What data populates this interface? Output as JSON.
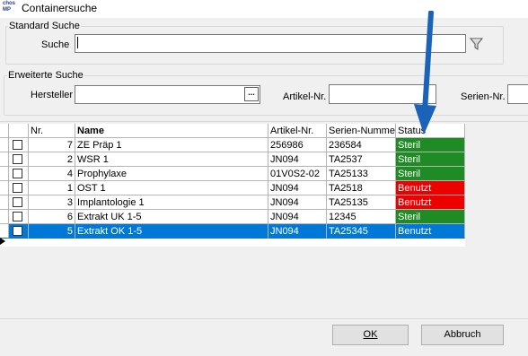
{
  "window": {
    "title": "Containersuche",
    "logo_line1": "chos",
    "logo_line2": "MP"
  },
  "standard_search": {
    "group_label": "Standard Suche",
    "search_label": "Suche",
    "search_value": ""
  },
  "extended_search": {
    "group_label": "Erweiterte Suche",
    "hersteller_label": "Hersteller",
    "hersteller_value": "",
    "hersteller_button": "...",
    "artikel_label": "Artikel-Nr.",
    "artikel_value": "",
    "serien_label": "Serien-Nr.",
    "serien_value": ""
  },
  "grid": {
    "columns": [
      "Nr.",
      "Name",
      "Artikel-Nr.",
      "Serien-Nummer",
      "Status"
    ],
    "rows": [
      {
        "nr": "7",
        "name": "ZE Präp 1",
        "artikel": "256986",
        "serien": "236584",
        "status": "Steril",
        "status_color": "#1f8b24"
      },
      {
        "nr": "2",
        "name": "WSR 1",
        "artikel": "JN094",
        "serien": "TA2537",
        "status": "Steril",
        "status_color": "#1f8b24"
      },
      {
        "nr": "4",
        "name": "Prophylaxe",
        "artikel": "01V0S2-02",
        "serien": "TA25133",
        "status": "Steril",
        "status_color": "#1f8b24"
      },
      {
        "nr": "1",
        "name": "OST 1",
        "artikel": "JN094",
        "serien": "TA2518",
        "status": "Benutzt",
        "status_color": "#ee0000"
      },
      {
        "nr": "3",
        "name": "Implantologie 1",
        "artikel": "JN094",
        "serien": "TA25135",
        "status": "Benutzt",
        "status_color": "#ee0000"
      },
      {
        "nr": "6",
        "name": "Extrakt UK 1-5",
        "artikel": "JN094",
        "serien": "12345",
        "status": "Steril",
        "status_color": "#1f8b24"
      },
      {
        "nr": "5",
        "name": "Extrakt OK 1-5",
        "artikel": "JN094",
        "serien": "TA25345",
        "status": "Benutzt",
        "status_color": "#0078d7",
        "selected": true
      }
    ]
  },
  "buttons": {
    "ok_label": "OK",
    "cancel_label": "Abbruch"
  },
  "colors": {
    "selection": "#0078d7",
    "status_green": "#1f8b24",
    "status_red": "#ee0000",
    "annotation_arrow": "#1a63b8"
  }
}
